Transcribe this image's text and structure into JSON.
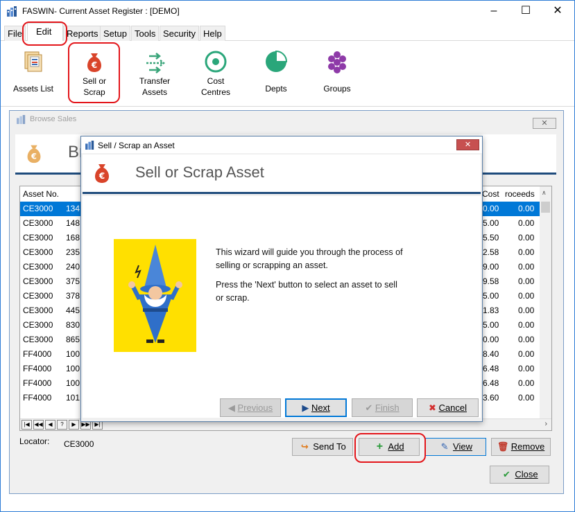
{
  "window": {
    "title": "FASWIN- Current Asset Register : [DEMO]",
    "minimize": "–",
    "maximize": "☐",
    "close": "✕"
  },
  "menu": [
    "File",
    "Edit",
    "Reports",
    "Setup",
    "Tools",
    "Security",
    "Help"
  ],
  "ribbon": {
    "assets_list": "Assets List",
    "sell_or_scrap_1": "Sell or",
    "sell_or_scrap_2": "Scrap",
    "transfer_1": "Transfer",
    "transfer_2": "Assets",
    "cost_1": "Cost",
    "cost_2": "Centres",
    "depts": "Depts",
    "groups": "Groups"
  },
  "browse": {
    "title": "Browse Sales",
    "header_partial": "Br",
    "columns": {
      "asset_no": "Asset No.",
      "cost": "Cost",
      "proceeds": "roceeds"
    },
    "rows": [
      {
        "asset": "CE3000",
        "num": "134",
        "cost": "0.00",
        "proceeds": "0.00"
      },
      {
        "asset": "CE3000",
        "num": "148",
        "cost": "5.00",
        "proceeds": "0.00"
      },
      {
        "asset": "CE3000",
        "num": "168",
        "cost": "5.50",
        "proceeds": "0.00"
      },
      {
        "asset": "CE3000",
        "num": "235",
        "cost": "2.58",
        "proceeds": "0.00"
      },
      {
        "asset": "CE3000",
        "num": "240",
        "cost": "9.00",
        "proceeds": "0.00"
      },
      {
        "asset": "CE3000",
        "num": "375",
        "cost": "9.58",
        "proceeds": "0.00"
      },
      {
        "asset": "CE3000",
        "num": "378",
        "cost": "5.00",
        "proceeds": "0.00"
      },
      {
        "asset": "CE3000",
        "num": "445",
        "cost": "1.83",
        "proceeds": "0.00"
      },
      {
        "asset": "CE3000",
        "num": "830",
        "cost": "5.00",
        "proceeds": "0.00"
      },
      {
        "asset": "CE3000",
        "num": "865",
        "cost": "0.00",
        "proceeds": "0.00"
      },
      {
        "asset": "FF4000",
        "num": "100",
        "cost": "8.40",
        "proceeds": "0.00"
      },
      {
        "asset": "FF4000",
        "num": "100",
        "cost": "6.48",
        "proceeds": "0.00"
      },
      {
        "asset": "FF4000",
        "num": "100",
        "cost": "6.48",
        "proceeds": "0.00"
      },
      {
        "asset": "FF4000",
        "num": "101",
        "cost": "3.60",
        "proceeds": "0.00"
      }
    ],
    "locator_label": "Locator:",
    "locator_value": "CE3000",
    "send_to": "Send To",
    "add": "Add",
    "view": "View",
    "remove": "Remove",
    "close": "Close"
  },
  "dialog": {
    "title": "Sell / Scrap an Asset",
    "heading": "Sell or Scrap Asset",
    "msg1_line1": "This wizard will guide you through the process of",
    "msg1_line2": "selling or scrapping an asset.",
    "msg2_line1": "Press the 'Next' button to select an asset to sell",
    "msg2_line2": "or scrap.",
    "previous": "Previous",
    "next": "Next",
    "finish": "Finish",
    "cancel": "Cancel"
  },
  "colors": {
    "selection": "#0078d7",
    "header_rule": "#1e4b7c",
    "money_bag": "#d9442a",
    "highlight": "#e3151a",
    "wizard_bg": "#ffe000"
  }
}
